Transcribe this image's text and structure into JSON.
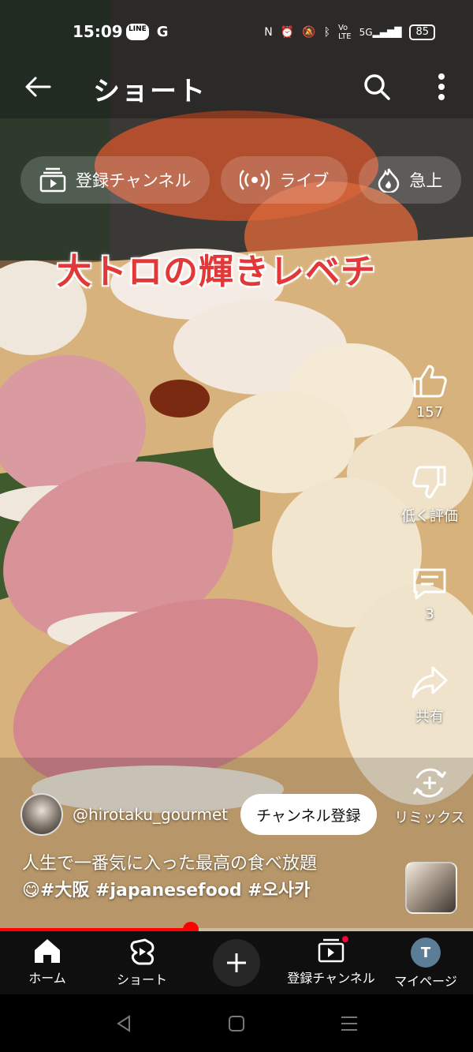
{
  "status_bar": {
    "time": "15:09",
    "left_icons": [
      "LINE",
      "G"
    ],
    "network": "5G",
    "battery": "85"
  },
  "app_bar": {
    "title": "ショート"
  },
  "chips": [
    {
      "label": "登録チャンネル",
      "icon": "subscriptions-icon"
    },
    {
      "label": "ライブ",
      "icon": "live-icon"
    },
    {
      "label": "急上",
      "icon": "trending-icon"
    }
  ],
  "video": {
    "overlay_text": "大トロの輝きレベチ"
  },
  "actions": {
    "like_count": "157",
    "dislike_label": "低く評価",
    "comment_count": "3",
    "share_label": "共有",
    "remix_label": "リミックス"
  },
  "channel": {
    "handle": "@hirotaku_gourmet",
    "subscribe_label": "チャンネル登録"
  },
  "description": {
    "line1": "人生で一番気に入った最高の食べ放題",
    "emoji": "😋",
    "tags": "#大阪 #japanesefood #오사카"
  },
  "progress": {
    "fraction": 0.403
  },
  "bottom_nav": {
    "home": "ホーム",
    "shorts": "ショート",
    "subscriptions": "登録チャンネル",
    "mypage": "マイページ",
    "avatar_letter": "T"
  },
  "colors": {
    "accent_red": "#ff0000",
    "overlay_text": "#e23838",
    "nav_bg": "#0f0f0f"
  }
}
